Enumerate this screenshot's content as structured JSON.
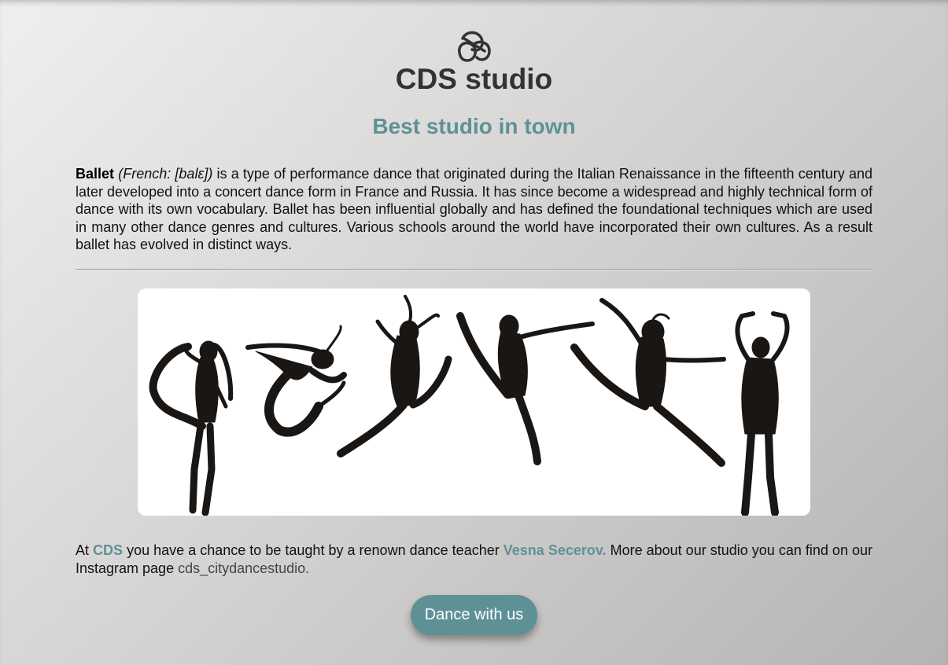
{
  "header": {
    "logo_icon": "ballet-shoes-icon",
    "title": "CDS studio",
    "tagline": "Best studio in town"
  },
  "intro": {
    "term": "Ballet",
    "pronunciation": "(French: [balɛ])",
    "text": " is a type of performance dance that originated during the Italian Renaissance in the fifteenth century and later developed into a concert dance form in France and Russia. It has since become a widespread and highly technical form of dance with its own vocabulary. Ballet has been influential globally and has defined the foundational techniques which are used in many other dance genres and cultures. Various schools around the world have incorporated their own cultures. As a result ballet has evolved in distinct ways."
  },
  "hero": {
    "image": "dancers-silhouettes"
  },
  "about": {
    "prefix": "At ",
    "studio": "CDS",
    "middle": " you have a chance to be taught by a renown dance teacher ",
    "teacher": "Vesna Secerov.",
    "suffix": " More about our studio you can find on our Instagram page ",
    "instagram": "cds_citydancestudio."
  },
  "cta": {
    "label": "Dance with us"
  },
  "colors": {
    "accent": "#5e9196",
    "title": "#333333",
    "text": "#111111"
  }
}
